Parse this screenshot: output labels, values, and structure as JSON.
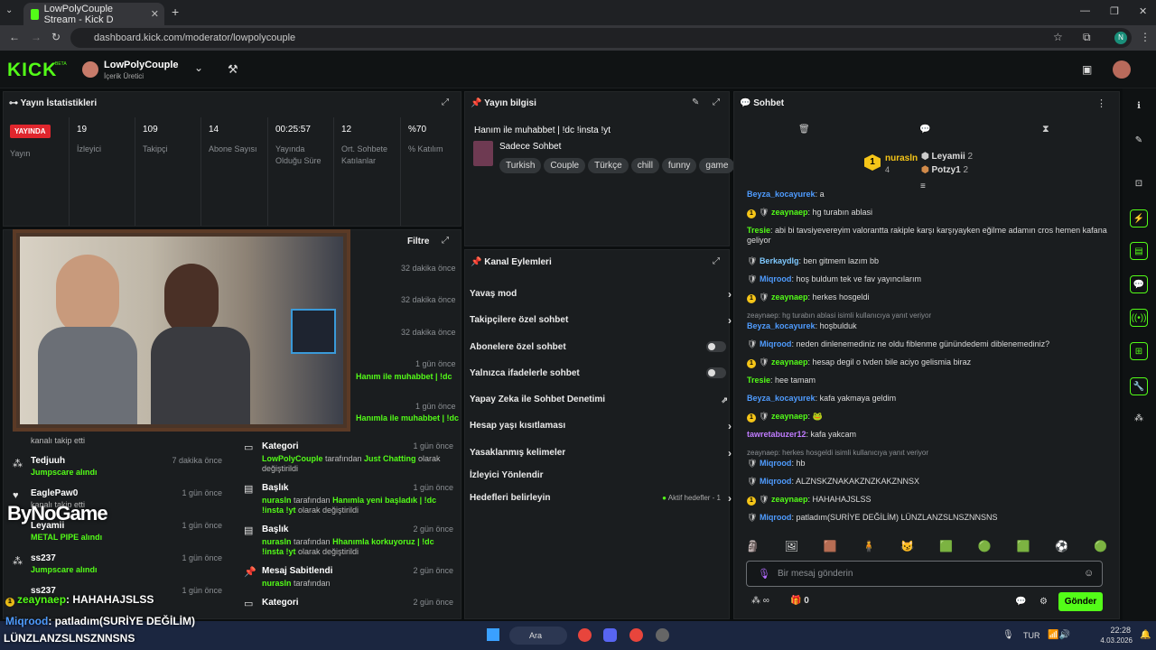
{
  "browser": {
    "tab_title": "LowPolyCouple Stream - Kick D",
    "url": "dashboard.kick.com/moderator/lowpolycouple",
    "profile_initial": "N"
  },
  "nav": {
    "logo": "KICK",
    "logo_sup": "BETA",
    "channel_name": "LowPolyCouple",
    "channel_role": "İçerik Üretici"
  },
  "stats": {
    "title": "Yayın İstatistikleri",
    "live_badge": "YAYINDA",
    "live_label": "Yayın",
    "items": [
      {
        "value": "19",
        "label": "İzleyici"
      },
      {
        "value": "109",
        "label": "Takipçi"
      },
      {
        "value": "14",
        "label": "Abone Sayısı"
      },
      {
        "value": "00:25:57",
        "label": "Yayında Olduğu Süre"
      },
      {
        "value": "12",
        "label": "Ort. Sohbete Katılanlar"
      },
      {
        "value": "%70",
        "label": "% Katılım"
      }
    ]
  },
  "stream_info": {
    "title": "Yayın bilgisi",
    "stream_title": "Hanım ile muhabbet | !dc !insta !yt",
    "category": "Sadece Sohbet",
    "tags": [
      "Turkish",
      "Couple",
      "Türkçe",
      "chill",
      "funny",
      "game"
    ]
  },
  "activity": {
    "filter": "Filtre",
    "times_right": [
      "32 dakika önce",
      "32 dakika önce",
      "32 dakika önce",
      "1 gün önce",
      "1 gün önce"
    ],
    "right_partial": [
      "Hanım ile muhabbet | !dc",
      "Hanımla ile muhabbet | !dc"
    ],
    "events": [
      {
        "head": "Kategori",
        "time": "1 gün önce",
        "user": "LowPolyCouple",
        "mid": " tarafından ",
        "val": "Just Chatting",
        "tail": " olarak değiştirildi"
      },
      {
        "head": "Başlık",
        "time": "1 gün önce",
        "user": "nurasln",
        "mid": " tarafından ",
        "val": "Hanımla yeni başladık | !dc !insta !yt",
        "tail": " olarak değiştirildi"
      },
      {
        "head": "Başlık",
        "time": "2 gün önce",
        "user": "nurasln",
        "mid": " tarafından ",
        "val": "Hhanımla korkuyoruz | !dc !insta !yt",
        "tail": " olarak değiştirildi"
      },
      {
        "head": "Mesaj Sabitlendi",
        "time": "2 gün önce",
        "user": "nurasln",
        "mid": " tarafından",
        "val": "",
        "tail": ""
      },
      {
        "head": "Kategori",
        "time": "2 gün önce",
        "user": "",
        "mid": "",
        "val": "",
        "tail": ""
      }
    ],
    "left": [
      {
        "name": "",
        "sub": "kanalı takip etti",
        "time": ""
      },
      {
        "name": "Tedjuuh",
        "sub": "Jumpscare alındı",
        "time": "7 dakika önce"
      },
      {
        "name": "EaglePaw0",
        "sub": "kanalı takip etti",
        "time": "1 gün önce"
      },
      {
        "name": "Leyamii",
        "sub": "METAL PIPE alındı",
        "time": "1 gün önce"
      },
      {
        "name": "ss237",
        "sub": "Jumpscare alındı",
        "time": "1 gün önce"
      },
      {
        "name": "ss237",
        "sub": "",
        "time": "1 gün önce"
      }
    ]
  },
  "overlay": {
    "watermark": "ByNoGame",
    "chat1_user": "zeaynaep",
    "chat1_text": ": HAHAHAJSLSS",
    "chat2_user": "Miqrood",
    "chat2_text": ": patladım(SURİYE DEĞİLİM)",
    "chat2_cont": "LÜNZLANZSLNSZNNSNS"
  },
  "channel_actions": {
    "title": "Kanal Eylemleri",
    "items": [
      "Yavaş mod",
      "Takipçilere özel sohbet",
      "Abonelere özel sohbet",
      "Yalnızca ifadelerle sohbet",
      "Yapay Zeka ile Sohbet Denetimi",
      "Hesap yaşı kısıtlaması",
      "Yasaklanmış kelimeler",
      "İzleyici Yönlendir",
      "Hedefleri belirleyin"
    ],
    "goal_status": "Aktif hedefler - 1"
  },
  "chat": {
    "title": "Sohbet",
    "leaders": [
      {
        "name": "nurasln",
        "count": "4",
        "rank": "1"
      },
      {
        "name": "Leyamii",
        "count": "2"
      },
      {
        "name": "Potzy1",
        "count": "2"
      }
    ],
    "messages": [
      {
        "user": "Beyza_kocayurek",
        "color": "#4f9cff",
        "text": ": a",
        "badge": ""
      },
      {
        "user": "zeaynaep",
        "color": "#53fc18",
        "text": ": hg turabın ablasi",
        "badge": "1"
      },
      {
        "user": "Tresie",
        "color": "#53fc18",
        "text": ": abi bi tavsiyevereyim valorantta rakiple karşı karşıyayken eğilme adamın cros hemen kafana geliyor",
        "badge": ""
      },
      {
        "user": "Berkaydlg",
        "color": "#7fc9ff",
        "text": ": ben gitmem lazım bb",
        "badge": "m"
      },
      {
        "user": "Miqrood",
        "color": "#4f9cff",
        "text": ": hoş buldum tek ve fav yayıncılarım",
        "badge": "m"
      },
      {
        "user": "zeaynaep",
        "color": "#53fc18",
        "text": ": herkes hosgeldi",
        "badge": "1"
      },
      {
        "user": "Beyza_kocayurek",
        "color": "#4f9cff",
        "text": ": hoşbulduk",
        "badge": "",
        "reply": "zeaynaep: hg turabın ablasi isimli kullanıcıya yanıt veriyor"
      },
      {
        "user": "Miqrood",
        "color": "#4f9cff",
        "text": ": neden dinlenemediniz ne oldu fiblenme günündedemi diblenemediniz?",
        "badge": "m"
      },
      {
        "user": "zeaynaep",
        "color": "#53fc18",
        "text": ": hesap degil o tvden bile aciyo gelismia biraz",
        "badge": "1"
      },
      {
        "user": "Tresie",
        "color": "#53fc18",
        "text": ": hee tamam",
        "badge": ""
      },
      {
        "user": "Beyza_kocayurek",
        "color": "#4f9cff",
        "text": ": kafa yakmaya geldim",
        "badge": ""
      },
      {
        "user": "zeaynaep",
        "color": "#53fc18",
        "text": ": 🐸",
        "badge": "1"
      },
      {
        "user": "tawretabuzer12",
        "color": "#c07cff",
        "text": ": kafa yakcam",
        "badge": ""
      },
      {
        "user": "Miqrood",
        "color": "#4f9cff",
        "text": ": hb",
        "badge": "m",
        "reply": "zeaynaep: herkes hosgeldi isimli kullanıcıya yanıt veriyor"
      },
      {
        "user": "Miqrood",
        "color": "#4f9cff",
        "text": ": ALZNSKZNAKAKZNZKAKZNNSX",
        "badge": "m"
      },
      {
        "user": "zeaynaep",
        "color": "#53fc18",
        "text": ": HAHAHAJSLSS",
        "badge": "1"
      },
      {
        "user": "Miqrood",
        "color": "#4f9cff",
        "text": ": patladım(SURİYE DEĞİLİM) LÜNZLANZSLNSZNNSNS",
        "badge": "m"
      }
    ],
    "input_placeholder": "Bir mesaj gönderin",
    "points": "0",
    "send": "Gönder"
  },
  "taskbar": {
    "search": "Ara",
    "lang": "TUR",
    "time": "22:28",
    "date": "4.03.2026"
  }
}
